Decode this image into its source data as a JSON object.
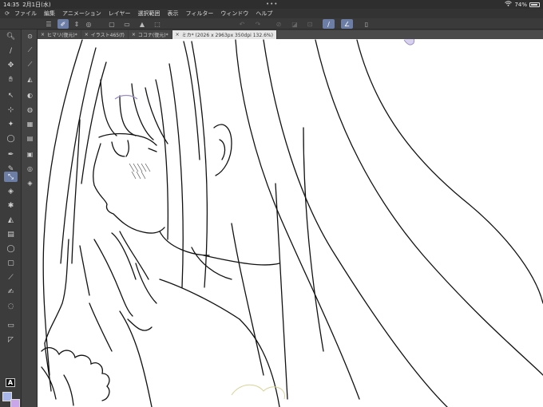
{
  "status_bar": {
    "time": "14:35",
    "date": "2月1日(水)",
    "battery": "74%",
    "dots": "•••"
  },
  "menu": {
    "items": [
      "ファイル",
      "編集",
      "アニメーション",
      "レイヤー",
      "選択範囲",
      "表示",
      "フィルター",
      "ウィンドウ",
      "ヘルプ"
    ]
  },
  "tabs": [
    {
      "label": "ヒマリ(復元)*",
      "active": false
    },
    {
      "label": "イラスト465(f)",
      "active": false
    },
    {
      "label": "ココナ(復元)*",
      "active": false
    },
    {
      "label": "ミカ* (2026 x 2963px 350dpi 132.6%)",
      "active": true
    }
  ],
  "toolbar": {
    "text_tool_label": "A"
  },
  "colors": {
    "accent": "#6d7ea6",
    "main_color": "#a8b5e8",
    "sub_color": "#c9a6e8"
  }
}
